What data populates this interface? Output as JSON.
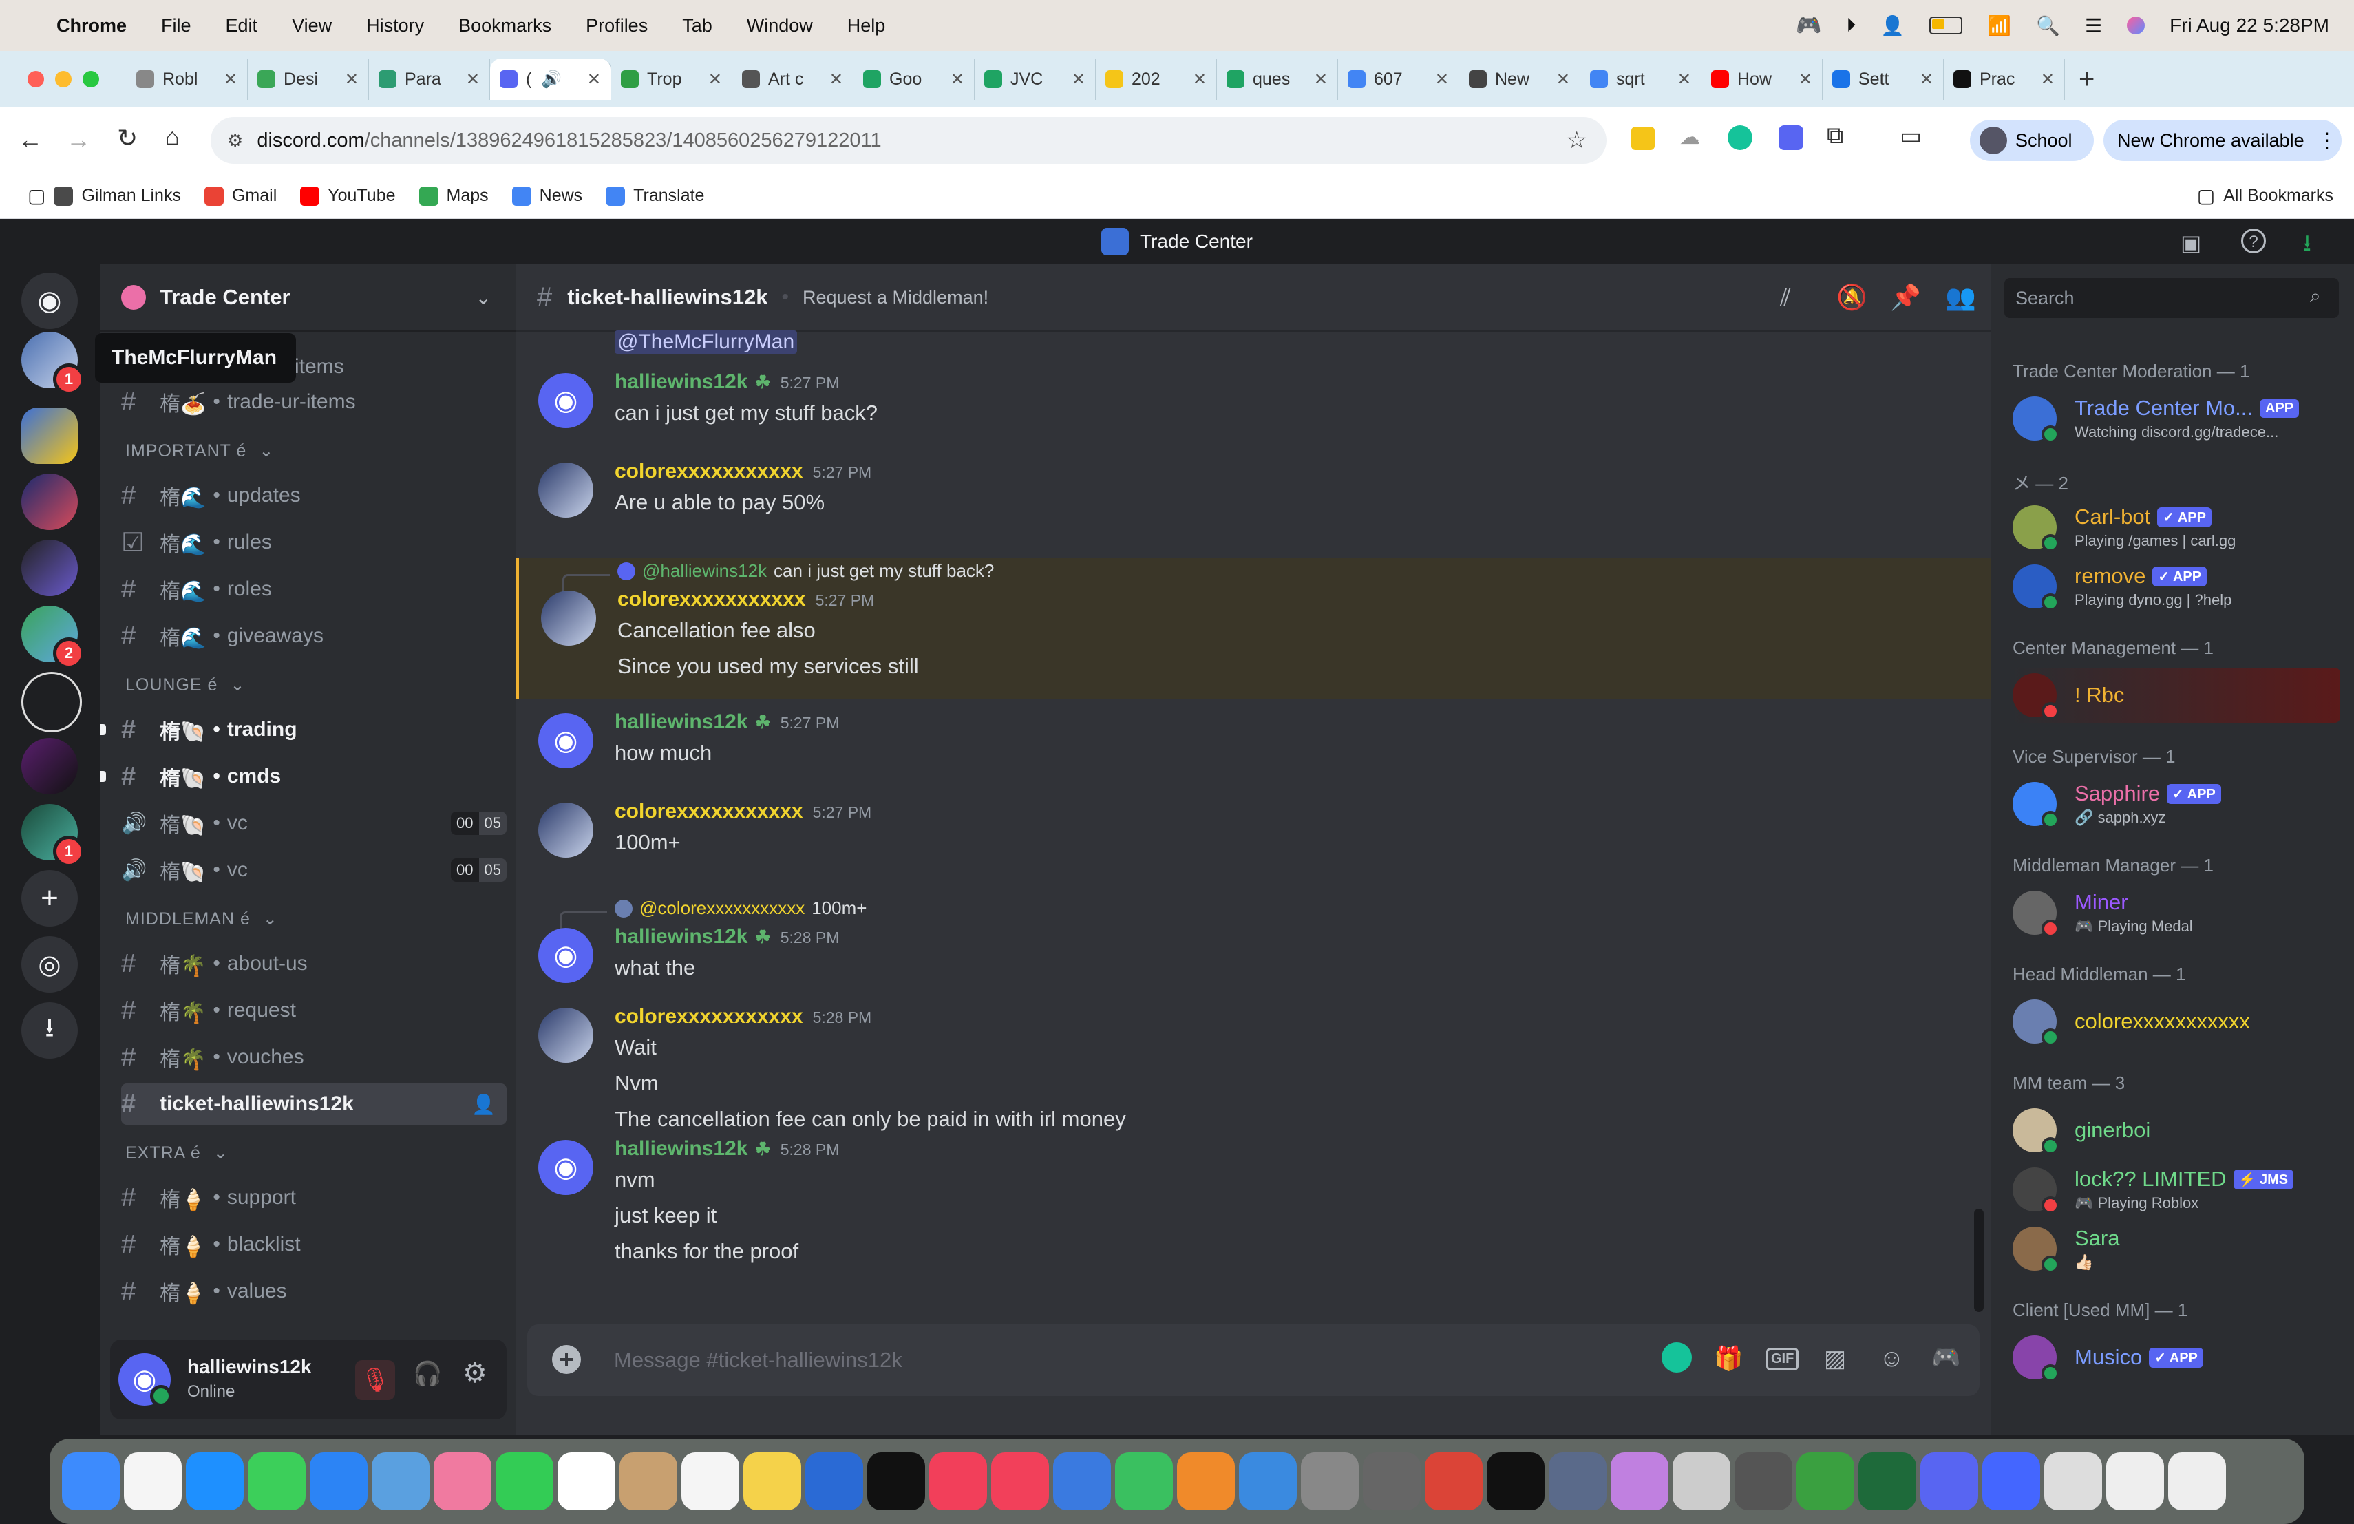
{
  "menubar": {
    "app": "Chrome",
    "items": [
      "File",
      "Edit",
      "View",
      "History",
      "Bookmarks",
      "Profiles",
      "Tab",
      "Window",
      "Help"
    ],
    "datetime": "Fri Aug 22  5:28PM"
  },
  "tabs": [
    {
      "label": "Robl",
      "color": "#888"
    },
    {
      "label": "Desi",
      "color": "#3aa757"
    },
    {
      "label": "Para",
      "color": "#2d9c72"
    },
    {
      "label": "(",
      "color": "#5865f2"
    },
    {
      "label": "Trop",
      "color": "#2f9e44"
    },
    {
      "label": "Art c",
      "color": "#555"
    },
    {
      "label": "Goo",
      "color": "#1fa463"
    },
    {
      "label": "JVC",
      "color": "#1fa463"
    },
    {
      "label": "202",
      "color": "#f5c518"
    },
    {
      "label": "ques",
      "color": "#1fa463"
    },
    {
      "label": "607",
      "color": "#4285f4"
    },
    {
      "label": "New",
      "color": "#444"
    },
    {
      "label": "sqrt",
      "color": "#4285f4"
    },
    {
      "label": "How",
      "color": "#ff0000"
    },
    {
      "label": "Sett",
      "color": "#1a73e8"
    },
    {
      "label": "Prac",
      "color": "#111"
    }
  ],
  "toolbar": {
    "url_domain": "discord.com",
    "url_path": "/channels/1389624961815285823/1408560256279122011",
    "profile": "School",
    "update": "New Chrome available"
  },
  "bookmarks": {
    "items": [
      {
        "label": "Gilman Links",
        "color": "#4a4a4a"
      },
      {
        "label": "Gmail",
        "color": "#ea4335"
      },
      {
        "label": "YouTube",
        "color": "#ff0000"
      },
      {
        "label": "Maps",
        "color": "#34a853"
      },
      {
        "label": "News",
        "color": "#4285f4"
      },
      {
        "label": "Translate",
        "color": "#4285f4"
      }
    ],
    "all": "All Bookmarks"
  },
  "app_title": "Trade Center",
  "tooltip": "TheMcFlurryMan",
  "server": {
    "name": "Trade Center",
    "partial_top": "items",
    "channels": [
      {
        "type": "text",
        "emoji": "楕🍝",
        "name": "trade-ur-items",
        "bright": false
      },
      {
        "type": "cat",
        "name": "IMPORTANT é"
      },
      {
        "type": "text",
        "emoji": "楕🌊",
        "name": "updates",
        "bright": false
      },
      {
        "type": "rules",
        "emoji": "楕🌊",
        "name": "rules",
        "bright": false
      },
      {
        "type": "text",
        "emoji": "楕🌊",
        "name": "roles",
        "bright": false
      },
      {
        "type": "text",
        "emoji": "楕🌊",
        "name": "giveaways",
        "bright": false
      },
      {
        "type": "cat",
        "name": "LOUNGE é"
      },
      {
        "type": "text",
        "emoji": "楕🐚",
        "name": "trading",
        "bright": true
      },
      {
        "type": "text",
        "emoji": "楕🐚",
        "name": "cmds",
        "bright": true
      },
      {
        "type": "voice",
        "emoji": "楕🐚",
        "name": "vc",
        "count_a": "00",
        "count_b": "05"
      },
      {
        "type": "voice",
        "emoji": "楕🐚",
        "name": "vc",
        "count_a": "00",
        "count_b": "05"
      },
      {
        "type": "cat",
        "name": "MIDDLEMAN é"
      },
      {
        "type": "text",
        "emoji": "楕🌴",
        "name": "about-us",
        "bright": false
      },
      {
        "type": "text",
        "emoji": "楕🌴",
        "name": "request",
        "bright": false
      },
      {
        "type": "text",
        "emoji": "楕🌴",
        "name": "vouches",
        "bright": false
      },
      {
        "type": "active",
        "emoji": "",
        "name": "ticket-halliewins12k",
        "bright": true
      },
      {
        "type": "cat",
        "name": "EXTRA é"
      },
      {
        "type": "text",
        "emoji": "楕🍦",
        "name": "support",
        "bright": false
      },
      {
        "type": "text",
        "emoji": "楕🍦",
        "name": "blacklist",
        "bright": false
      },
      {
        "type": "text",
        "emoji": "楕🍦",
        "name": "values",
        "bright": false
      }
    ]
  },
  "user": {
    "name": "halliewins12k",
    "status": "Online"
  },
  "channel": {
    "name": "ticket-halliewins12k",
    "topic": "Request a Middleman!",
    "search_placeholder": "Search"
  },
  "chat": {
    "mention_top": "@TheMcFlurryMan",
    "messages": [
      {
        "author": "halliewins12k",
        "kind": "hallie",
        "time": "5:27 PM",
        "lines": [
          "can i just get my stuff back?"
        ]
      },
      {
        "author": "colorexxxxxxxxxxx",
        "kind": "color",
        "time": "5:27 PM",
        "lines": [
          "Are u able to pay 50%"
        ]
      },
      {
        "author": "colorexxxxxxxxxxx",
        "kind": "color",
        "time": "5:27 PM",
        "reply_user": "@halliewins12k",
        "reply_text": "can i just get my stuff back?",
        "lines": [
          "Cancellation fee also",
          "Since you used my services still"
        ],
        "highlight": true
      },
      {
        "author": "halliewins12k",
        "kind": "hallie",
        "time": "5:27 PM",
        "lines": [
          "how much"
        ]
      },
      {
        "author": "colorexxxxxxxxxxx",
        "kind": "color",
        "time": "5:27 PM",
        "lines": [
          "100m+"
        ]
      },
      {
        "author": "halliewins12k",
        "kind": "hallie",
        "time": "5:28 PM",
        "reply_user": "@colorexxxxxxxxxxx",
        "reply_text": "100m+",
        "lines": [
          "what the"
        ]
      },
      {
        "author": "colorexxxxxxxxxxx",
        "kind": "color",
        "time": "5:28 PM",
        "lines": [
          "Wait",
          "Nvm",
          "The cancellation fee can only be paid in with irl money"
        ]
      },
      {
        "author": "halliewins12k",
        "kind": "hallie",
        "time": "5:28 PM",
        "lines": [
          "nvm",
          "just keep it",
          "thanks for the proof"
        ]
      }
    ],
    "input_placeholder": "Message #ticket-halliewins12k"
  },
  "members": {
    "groups": [
      {
        "title": "Trade Center Moderation — 1",
        "members": [
          {
            "name": "Trade Center Mo...",
            "sub": "Watching discord.gg/tradece...",
            "color": "#7b9cff",
            "tag": "APP",
            "avatar": "#3b6fd6"
          }
        ]
      },
      {
        "title": "メ — 2",
        "members": [
          {
            "name": "Carl-bot",
            "sub": "Playing /games | carl.gg",
            "color": "#f0b232",
            "tag": "✓ APP",
            "avatar": "#8aa04a"
          },
          {
            "name": "remove",
            "sub": "Playing dyno.gg | ?help",
            "color": "#f0b232",
            "tag": "✓ APP",
            "avatar": "#2a5dc4"
          }
        ]
      },
      {
        "title": "Center Management — 1",
        "members": [
          {
            "name": "! Rbc",
            "sub": "",
            "color": "#f0b232",
            "tag": "",
            "avatar": "#5a1a1a"
          }
        ]
      },
      {
        "title": "Vice Supervisor — 1",
        "members": [
          {
            "name": "Sapphire",
            "sub": "🔗 sapph.xyz",
            "color": "#eb6fa8",
            "tag": "✓ APP",
            "avatar": "#3b82f6"
          }
        ]
      },
      {
        "title": "Middleman Manager — 1",
        "members": [
          {
            "name": "Miner",
            "sub": "🎮 Playing Medal",
            "color": "#9b59ff",
            "tag": "",
            "avatar": "#666"
          }
        ]
      },
      {
        "title": "Head Middleman — 1",
        "members": [
          {
            "name": "colorexxxxxxxxxxx",
            "sub": "",
            "color": "#f1d42e",
            "tag": "",
            "avatar": "#6a7fb0"
          }
        ]
      },
      {
        "title": "MM team — 3",
        "members": [
          {
            "name": "ginerboi",
            "sub": "",
            "color": "#6fd98a",
            "tag": "",
            "avatar": "#c9b99a"
          },
          {
            "name": "lock?? LIMITED",
            "sub": "🎮 Playing Roblox",
            "color": "#6fd98a",
            "tag": "⚡ JMS",
            "avatar": "#444"
          },
          {
            "name": "Sara",
            "sub": "👍🏻",
            "color": "#6fd98a",
            "tag": "",
            "avatar": "#8a6a4a"
          }
        ]
      },
      {
        "title": "Client [Used MM] — 1",
        "members": [
          {
            "name": "Musico",
            "sub": "",
            "color": "#7b9cff",
            "tag": "✓ APP",
            "avatar": "#8844aa"
          }
        ]
      }
    ]
  },
  "colors": {
    "discord": "#5865f2",
    "hallie": "#5eb56d",
    "colore": "#f1d42e"
  }
}
